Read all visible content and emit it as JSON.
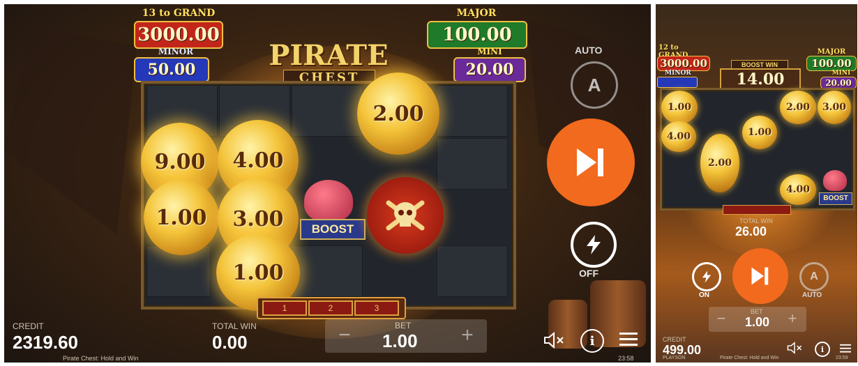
{
  "left": {
    "jackpots": {
      "grand_label": "13 to GRAND",
      "grand_value": "3000.00",
      "major_label": "MAJOR",
      "major_value": "100.00",
      "minor_label": "MINOR",
      "minor_value": "50.00",
      "mini_label": "MINI",
      "mini_value": "20.00"
    },
    "logo": {
      "line1": "PIRATE",
      "line2": "CHEST"
    },
    "coins": [
      "2.00",
      "9.00",
      "4.00",
      "1.00",
      "3.00",
      "1.00"
    ],
    "boost_label": "BOOST",
    "respins": [
      "1",
      "2",
      "3"
    ],
    "controls": {
      "auto_label": "AUTO",
      "auto_glyph": "A",
      "turbo_state": "OFF"
    },
    "footer": {
      "credit_label": "CREDIT",
      "credit_value": "2319.60",
      "total_win_label": "TOTAL WIN",
      "total_win_value": "0.00",
      "bet_label": "BET",
      "bet_value": "1.00",
      "bet_minus": "−",
      "bet_plus": "+",
      "footer_text": "Pirate Chest: Hold and Win",
      "clock": "23:58"
    },
    "icons": [
      "sound-muted-icon",
      "info-icon",
      "menu-icon",
      "play-skip-icon",
      "lightning-icon",
      "auto-spin-icon"
    ]
  },
  "right": {
    "jackpots": {
      "grand_label": "12 to GRAND",
      "grand_value": "3000.00",
      "major_label": "MAJOR",
      "major_value": "100.00",
      "minor_label": "MINOR",
      "mini_label": "MINI",
      "mini_value": "20.00"
    },
    "boost_win_label": "BOOST WIN",
    "boost_win_value": "14.00",
    "coins": [
      "1.00",
      "2.00",
      "3.00",
      "4.00",
      "1.00",
      "2.00",
      "4.00"
    ],
    "boost_label": "BOOST",
    "total_win_label": "TOTAL WIN",
    "total_win_value": "26.00",
    "controls": {
      "turbo_state": "ON",
      "auto_label": "AUTO",
      "auto_glyph": "A"
    },
    "footer": {
      "bet_label": "BET",
      "bet_value": "1.00",
      "bet_minus": "−",
      "bet_plus": "+",
      "credit_label": "CREDIT",
      "credit_value": "499.00",
      "brand": "PLAYSON",
      "footer_text": "Pirate Chest: Hold and Win",
      "clock": "23:59"
    }
  },
  "colors": {
    "orange_button": "#f26a1e",
    "gold": "#f4c43a",
    "grand_red": "#c2261a",
    "major_green": "#1f7a2a",
    "minor_blue": "#2438b8",
    "mini_purple": "#6a2a9a"
  }
}
